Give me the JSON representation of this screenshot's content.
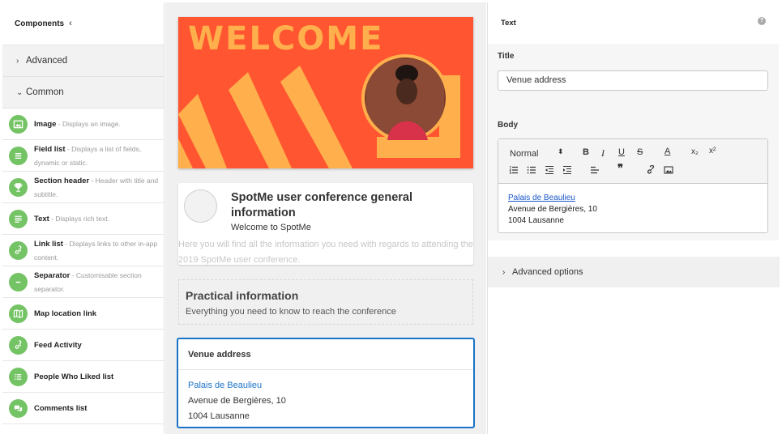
{
  "sidebar": {
    "title": "Components",
    "groups": [
      {
        "label": "Advanced",
        "caret": "›"
      },
      {
        "label": "Common",
        "caret": "⌄"
      }
    ],
    "components": [
      {
        "name": "Image",
        "desc": " - Displays an image.",
        "icon": "image-icon"
      },
      {
        "name": "Field list",
        "desc": " - Displays a list of fields, dynamic or static.",
        "icon": "list-icon"
      },
      {
        "name": "Section header",
        "desc": " - Header with title and subtitle.",
        "icon": "trophy-icon"
      },
      {
        "name": "Text",
        "desc": " - Displays rich text.",
        "icon": "text-icon"
      },
      {
        "name": "Link list",
        "desc": " - Displays links to other in-app content.",
        "icon": "link-icon"
      },
      {
        "name": "Separator",
        "desc": " - Customisable section separator.",
        "icon": "minus-icon"
      },
      {
        "name": "Map location link",
        "desc": "",
        "icon": "map-icon"
      },
      {
        "name": "Feed Activity",
        "desc": "",
        "icon": "link-icon"
      },
      {
        "name": "People Who Liked list",
        "desc": "",
        "icon": "list-icon"
      },
      {
        "name": "Comments list",
        "desc": "",
        "icon": "comments-icon"
      }
    ]
  },
  "canvas": {
    "banner": {
      "text": "WELCOME"
    },
    "info_card": {
      "title": "SpotMe user conference general information",
      "subtitle": "Welcome to SpotMe",
      "body": "Here you will find all the information you need with regards to attending the 2019 SpotMe user conference."
    },
    "practical": {
      "title": "Practical information",
      "subtitle": "Everything you need to know to reach the conference"
    },
    "venue": {
      "title": "Venue address",
      "link": "Palais de Beaulieu",
      "line2": "Avenue de Bergières, 10",
      "line3": "1004 Lausanne"
    }
  },
  "panel": {
    "header": "Text",
    "help": "?",
    "title_label": "Title",
    "title_value": "Venue address",
    "body_label": "Body",
    "toolbar": {
      "format": "Normal",
      "bold": "B",
      "italic": "I",
      "underline": "U",
      "strike": "S",
      "color": "A",
      "subscript": "x₂",
      "superscript": "x²",
      "quote": "❞"
    },
    "body": {
      "link": "Palais de Beaulieu",
      "line2": "Avenue de Bergières, 10",
      "line3": "1004 Lausanne"
    },
    "advanced": "Advanced options"
  },
  "colors": {
    "accent": "#1a73c9",
    "component_icon": "#74c365",
    "banner_bg": "#ff5530",
    "banner_fg": "#ffb04c"
  }
}
